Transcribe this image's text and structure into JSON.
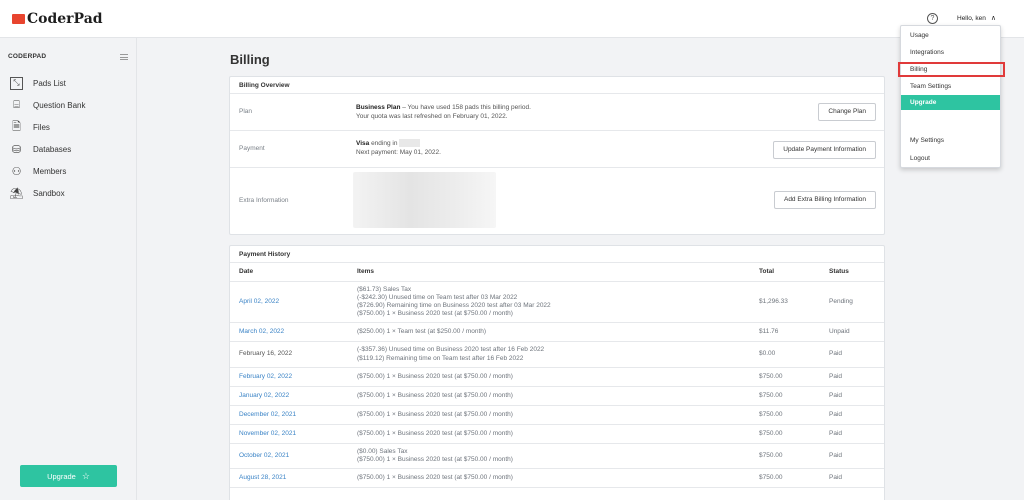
{
  "header": {
    "logo_text": "CoderPad",
    "greeting": "Hello, ken"
  },
  "sidebar": {
    "title": "CODERPAD",
    "items": [
      {
        "label": "Pads List",
        "icon": "pad-icon"
      },
      {
        "label": "Question Bank",
        "icon": "question-bank-icon"
      },
      {
        "label": "Files",
        "icon": "file-icon"
      },
      {
        "label": "Databases",
        "icon": "database-icon"
      },
      {
        "label": "Members",
        "icon": "members-icon"
      },
      {
        "label": "Sandbox",
        "icon": "sandbox-icon"
      }
    ],
    "upgrade_label": "Upgrade"
  },
  "page_title": "Billing",
  "overview": {
    "title": "Billing Overview",
    "plan_label": "Plan",
    "plan_name": "Business Plan",
    "plan_text": " – You have used 158 pads this billing period.",
    "plan_refresh": "Your quota was last refreshed on February 01, 2022.",
    "change_plan": "Change Plan",
    "payment_label": "Payment",
    "card_brand": "Visa",
    "card_text": " ending in ",
    "next_payment": "Next payment: May 01, 2022.",
    "update_payment": "Update Payment Information",
    "extra_label": "Extra Information",
    "add_extra": "Add Extra Billing Information"
  },
  "history": {
    "title": "Payment History",
    "columns": [
      "Date",
      "Items",
      "Total",
      "Status"
    ],
    "rows": [
      {
        "date": "April 02, 2022",
        "link": true,
        "items": [
          "($61.73) Sales Tax",
          "(-$242.30) Unused time on Team test after 03 Mar 2022",
          "($726.90) Remaining time on Business 2020 test after 03 Mar 2022",
          "($750.00) 1 × Business 2020 test (at $750.00 / month)"
        ],
        "total": "$1,296.33",
        "status": "Pending"
      },
      {
        "date": "March 02, 2022",
        "link": true,
        "items": [
          "($250.00) 1 × Team test (at $250.00 / month)"
        ],
        "total": "$11.76",
        "status": "Unpaid"
      },
      {
        "date": "February 16, 2022",
        "link": false,
        "items": [
          "(-$357.36) Unused time on Business 2020 test after 16 Feb 2022",
          "($119.12) Remaining time on Team test after 16 Feb 2022"
        ],
        "total": "$0.00",
        "status": "Paid"
      },
      {
        "date": "February 02, 2022",
        "link": true,
        "items": [
          "($750.00) 1 × Business 2020 test (at $750.00 / month)"
        ],
        "total": "$750.00",
        "status": "Paid"
      },
      {
        "date": "January 02, 2022",
        "link": true,
        "items": [
          "($750.00) 1 × Business 2020 test (at $750.00 / month)"
        ],
        "total": "$750.00",
        "status": "Paid"
      },
      {
        "date": "December 02, 2021",
        "link": true,
        "items": [
          "($750.00) 1 × Business 2020 test (at $750.00 / month)"
        ],
        "total": "$750.00",
        "status": "Paid"
      },
      {
        "date": "November 02, 2021",
        "link": true,
        "items": [
          "($750.00) 1 × Business 2020 test (at $750.00 / month)"
        ],
        "total": "$750.00",
        "status": "Paid"
      },
      {
        "date": "October 02, 2021",
        "link": true,
        "items": [
          "($0.00) Sales Tax",
          "($750.00) 1 × Business 2020 test (at $750.00 / month)"
        ],
        "total": "$750.00",
        "status": "Paid"
      },
      {
        "date": "August 28, 2021",
        "link": true,
        "items": [
          "($750.00) 1 × Business 2020 test (at $750.00 / month)"
        ],
        "total": "$750.00",
        "status": "Paid"
      }
    ]
  },
  "dropdown": {
    "items": [
      "Usage",
      "Integrations",
      "Billing",
      "Team Settings",
      "Upgrade",
      "My Settings",
      "Logout"
    ]
  },
  "colors": {
    "accent": "#2ec4a1",
    "link": "#3a83c6",
    "highlight_border": "#e03a3a",
    "logo": "#e8442e"
  }
}
